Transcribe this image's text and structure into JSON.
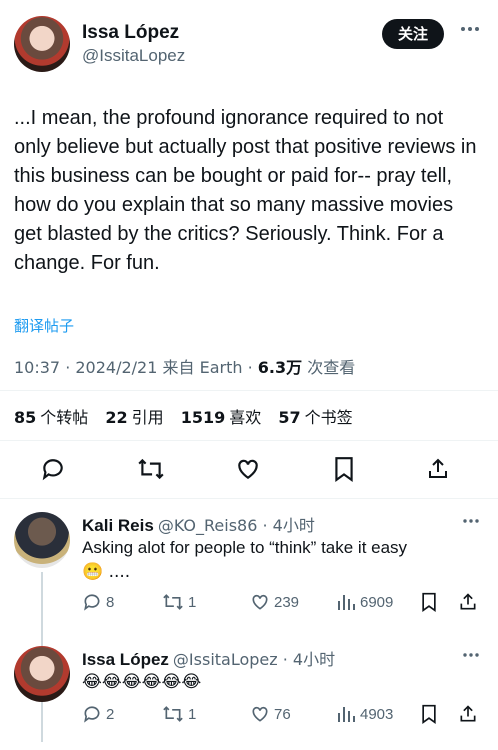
{
  "post": {
    "author_name": "Issa López",
    "author_handle": "@IssitaLopez",
    "follow_label": "关注",
    "text": "...I mean, the profound ignorance required to not only believe but actually post that positive reviews in this business can be bought or paid for-- pray tell, how do you explain that so many massive movies get blasted by the critics? Seriously. Think. For a change. For fun.",
    "translate_label": "翻译帖子",
    "timestamp": "10:37 · 2024/2/21 来自 Earth · ",
    "views_count": "6.3万",
    "views_label": " 次查看"
  },
  "stats": [
    {
      "num": "85",
      "label": "个转帖"
    },
    {
      "num": "22",
      "label": "引用"
    },
    {
      "num": "1519",
      "label": "喜欢"
    },
    {
      "num": "57",
      "label": "个书签"
    }
  ],
  "replies": [
    {
      "name": "Kali Reis",
      "meta": "@KO_Reis86 · 4小时",
      "text": "Asking alot for people to “think” take it easy",
      "text2": "😬 ....",
      "replies_count": "8",
      "retweets_count": "1",
      "likes_count": "239",
      "views_count": "6909"
    },
    {
      "name": "Issa López",
      "meta": "@IssitaLopez · 4小时",
      "text": "😂😂😂😂😂😂",
      "replies_count": "2",
      "retweets_count": "1",
      "likes_count": "76",
      "views_count": "4903"
    }
  ],
  "icons": {
    "more": "more-horizontal-icon",
    "reply": "reply-icon",
    "retweet": "retweet-icon",
    "like": "heart-icon",
    "bookmark": "bookmark-icon",
    "share": "share-icon",
    "views": "analytics-icon"
  },
  "colors": {
    "text": "#0f1419",
    "secondary": "#536471",
    "link": "#1d9bf0",
    "button_bg": "#0f1419",
    "divider": "#eff3f4"
  }
}
